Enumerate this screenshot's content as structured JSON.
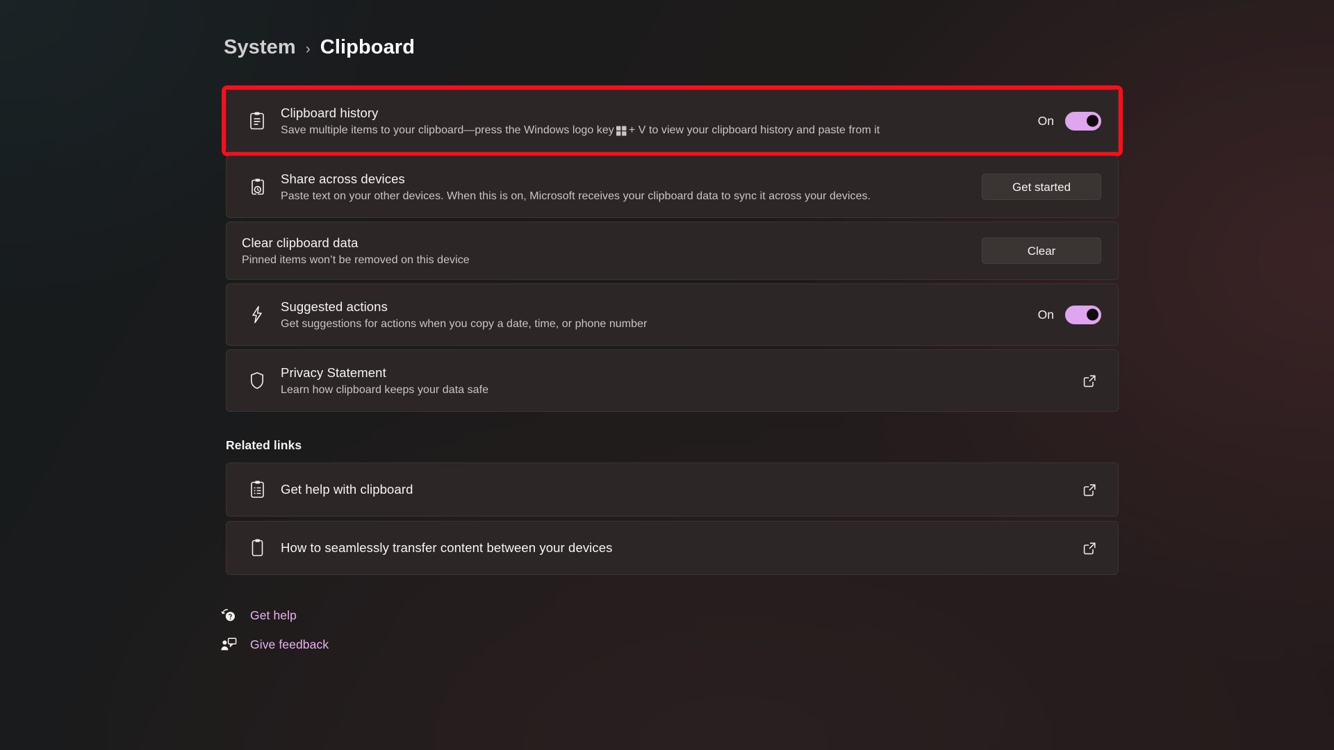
{
  "breadcrumb": {
    "parent": "System",
    "separator": "›",
    "current": "Clipboard"
  },
  "settings": [
    {
      "id": "clipboard-history",
      "icon": "clipboard-history-icon",
      "title": "Clipboard history",
      "desc_before": "Save multiple items to your clipboard—press the Windows logo key",
      "desc_after": "+ V to view your clipboard history and paste from it",
      "control": "toggle",
      "toggle_label": "On",
      "toggle_state": "on",
      "highlighted": true
    },
    {
      "id": "share-across-devices",
      "icon": "clipboard-sync-icon",
      "title": "Share across devices",
      "desc": "Paste text on your other devices. When this is on, Microsoft receives your clipboard data to sync it across your devices.",
      "control": "button",
      "button_label": "Get started"
    },
    {
      "id": "clear-clipboard-data",
      "icon": null,
      "title": "Clear clipboard data",
      "desc": "Pinned items won’t be removed on this device",
      "control": "button",
      "button_label": "Clear"
    },
    {
      "id": "suggested-actions",
      "icon": "lightning-bolt-icon",
      "title": "Suggested actions",
      "desc": "Get suggestions for actions when you copy a date, time, or phone number",
      "control": "toggle",
      "toggle_label": "On",
      "toggle_state": "on"
    },
    {
      "id": "privacy-statement",
      "icon": "shield-icon",
      "title": "Privacy Statement",
      "desc": "Learn how clipboard keeps your data safe",
      "control": "external-link"
    }
  ],
  "related": {
    "header": "Related links",
    "items": [
      {
        "id": "get-help-with-clipboard",
        "icon": "clipboard-list-icon",
        "title": "Get help with clipboard"
      },
      {
        "id": "how-to-transfer-content",
        "icon": "clipboard-blank-icon",
        "title": "How to seamlessly transfer content between your devices"
      }
    ]
  },
  "footer": {
    "items": [
      {
        "id": "get-help",
        "icon": "help-question-icon",
        "label": "Get help"
      },
      {
        "id": "give-feedback",
        "icon": "feedback-person-icon",
        "label": "Give feedback"
      }
    ]
  },
  "colors": {
    "accent_toggle": "#e0a5ef",
    "accent_link": "#e6b4f2",
    "highlight_border": "#fc0d1b",
    "card_bg": "#2c2726",
    "button_bg": "#3a3433"
  }
}
